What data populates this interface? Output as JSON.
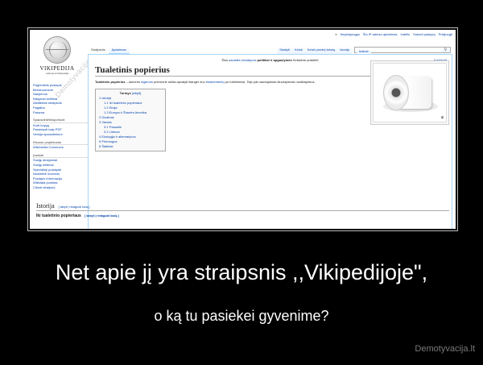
{
  "personal": [
    "Neprisijungęs",
    "Šio IP adreso aptarimas",
    "Indėlis",
    "Sukurti paskyrą",
    "Prisijungti"
  ],
  "logo": {
    "title": "VIKIPEDIJA",
    "subtitle": "Laisvoji enciklopedija"
  },
  "watermark": "Demotyvacija.lt",
  "tabs_left": [
    "Straipsnis",
    "Aptarimas"
  ],
  "tabs_right": [
    "Skaityti",
    "Keisti",
    "Keisti pirminį tekstą",
    "Istorija"
  ],
  "search": {
    "placeholder": "Ieškoti"
  },
  "sidebar": {
    "main": [
      "Pagrindinis puslapis",
      "Bendruomenė",
      "Naujienos",
      "Naujausi keitimai",
      "Atsitiktinis straipsnis",
      "Pagalba",
      "Parama"
    ],
    "print_header": "Spausdinti/eksportuoti",
    "print": [
      "Kurti knygą",
      "Parsisiųsti kaip PDF",
      "Versija spausdinimui"
    ],
    "other_header": "Kituose projektuose",
    "other": [
      "Wikimedia Commons"
    ],
    "tools_header": "Įrankiai",
    "tools": [
      "Susiję straipsniai",
      "Susiję keitimai",
      "Specialieji puslapiai",
      "Nuolatinė nuoroda",
      "Puslapio informacija",
      "Wikidata punktas",
      "Cituoti straipsnį"
    ]
  },
  "sitenotice": {
    "pre": "Šios",
    "link": "savaitės iniciatyvos",
    "bold": "politikai ir apgaulymės",
    "post": "Keiskime prašėtė!",
    "edit": "[paslėpti]"
  },
  "page_title": "Tualetinis popierius",
  "lead": {
    "bold": "Tualetinis popierius",
    "t1": " – asmens ",
    "link1": "higienos",
    "t2": " priemonė skirta apvalyti išangei nuo ",
    "link2": "ekskrementų",
    "t3": " po tuštinimosi. Taip pat naudojamas šluostymuisi nosišlapimus."
  },
  "toc": {
    "title": "Turinys",
    "toggle": "[slėpti]",
    "items": [
      {
        "text": "1 Istorija",
        "level": 1
      },
      {
        "text": "1.1 Iki tualetinio popieriaus",
        "level": 2
      },
      {
        "text": "1.2 Kinija",
        "level": 2
      },
      {
        "text": "1.3 Europa ir Šiaurės Amerika",
        "level": 2
      },
      {
        "text": "2 Dizainas",
        "level": 1
      },
      {
        "text": "3 Vardas",
        "level": 1
      },
      {
        "text": "3.1 Pasaulis",
        "level": 2
      },
      {
        "text": "3.2 Lietuva",
        "level": 2
      },
      {
        "text": "4 Ekologija ir alternatyvos",
        "level": 1
      },
      {
        "text": "5 Priemogos",
        "level": 1
      },
      {
        "text": "6 Šaltiniai",
        "level": 1
      }
    ]
  },
  "section": {
    "title": "Istorija",
    "edit": "[ taisyti | redaguoti kodą ]"
  },
  "subsection": {
    "title": "Iki tualetinio popieriaus",
    "edit": "[ taisyti | redaguoti kodą ]"
  },
  "caption": "Net apie jį yra straipsnis ,,Vikipedijoje\",",
  "subcaption": "o ką tu pasiekei gyvenime?",
  "brand": "Demotyvacija.lt"
}
